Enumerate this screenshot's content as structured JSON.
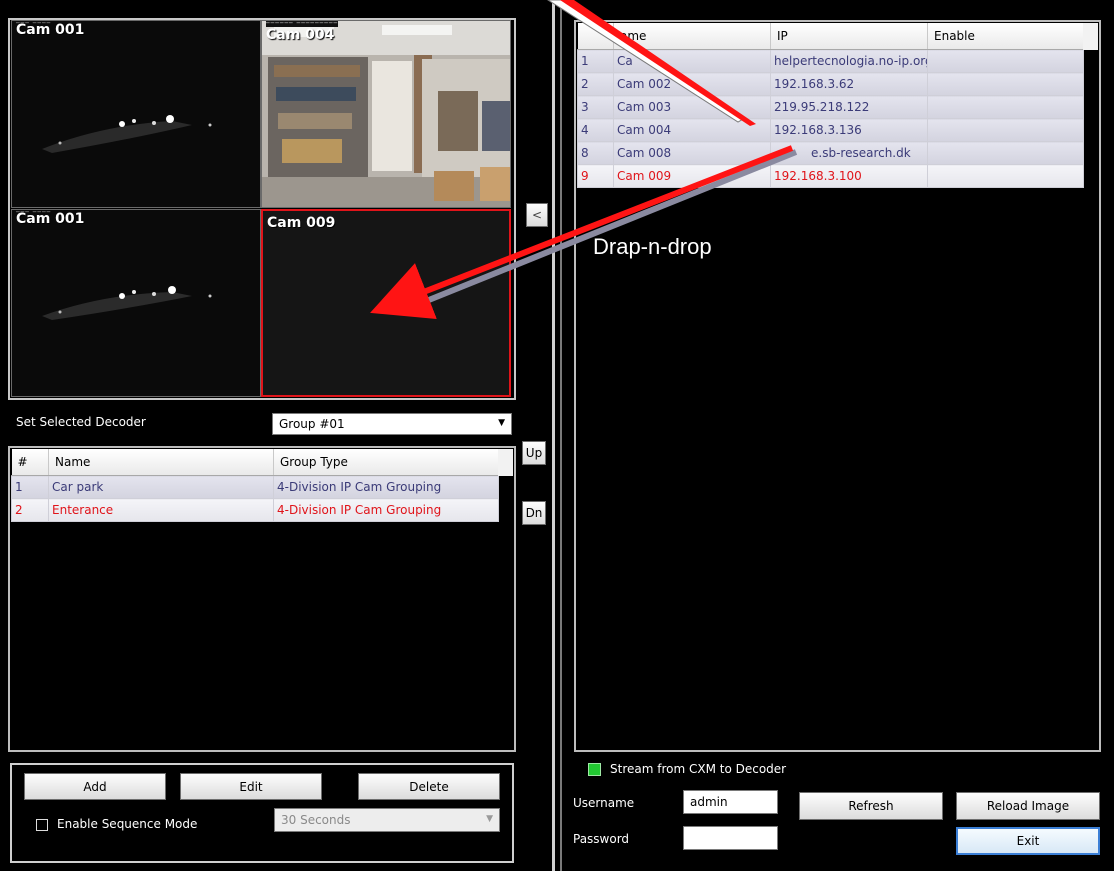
{
  "cameras": {
    "tile1": {
      "label": "Cam 001"
    },
    "tile2": {
      "label": "Cam 004"
    },
    "tile3": {
      "label": "Cam 001"
    },
    "tile4": {
      "label": "Cam 009"
    }
  },
  "nav": {
    "left_arrow": "<",
    "up": "Up",
    "down": "Dn"
  },
  "decoder": {
    "label": "Set Selected Decoder",
    "selected": "Group #01"
  },
  "groups": {
    "headers": [
      "#",
      "Name",
      "Group Type"
    ],
    "rows": [
      {
        "num": "1",
        "name": "Car park",
        "type": "4-Division IP Cam Grouping"
      },
      {
        "num": "2",
        "name": "Enterance",
        "type": "4-Division IP Cam Grouping"
      }
    ]
  },
  "group_actions": {
    "add": "Add",
    "edit": "Edit",
    "delete": "Delete",
    "sequence_label": "Enable Sequence Mode",
    "sequence_interval": "30 Seconds"
  },
  "cam_list": {
    "headers": [
      "ame",
      "IP",
      "Enable"
    ],
    "rows": [
      {
        "num": "1",
        "name": "Ca",
        "ip": "helpertecnologia.no-ip.org",
        "enable": ""
      },
      {
        "num": "2",
        "name": "Cam 002",
        "ip": "192.168.3.62",
        "enable": ""
      },
      {
        "num": "3",
        "name": "Cam 003",
        "ip": "219.95.218.122",
        "enable": ""
      },
      {
        "num": "4",
        "name": "Cam 004",
        "ip": "192.168.3.136",
        "enable": ""
      },
      {
        "num": "8",
        "name": "Cam 008",
        "ip": "e.sb-research.dk",
        "enable": ""
      },
      {
        "num": "9",
        "name": "Cam 009",
        "ip": "192.168.3.100",
        "enable": ""
      }
    ]
  },
  "annotation": {
    "text": "Drap-n-drop"
  },
  "stream": {
    "label": "Stream from CXM to Decoder"
  },
  "login": {
    "username_label": "Username",
    "username_value": "admin",
    "password_label": "Password",
    "password_value": ""
  },
  "right_actions": {
    "refresh": "Refresh",
    "reload": "Reload Image",
    "exit": "Exit"
  },
  "colors": {
    "accent_red": "#e0141a",
    "status_green": "#22c832"
  }
}
